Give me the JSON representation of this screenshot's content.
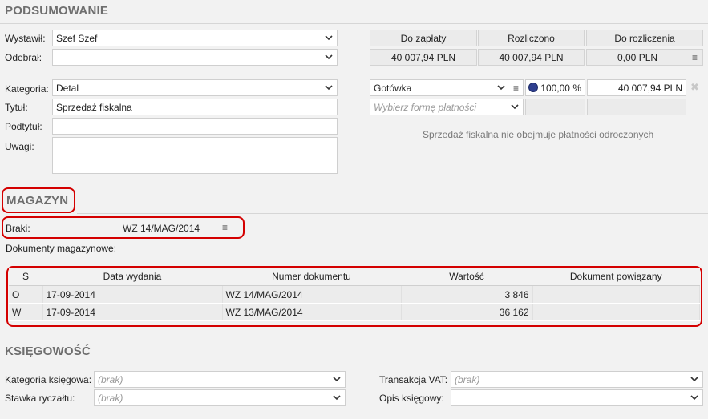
{
  "summary": {
    "title": "PODSUMOWANIE",
    "issued_label": "Wystawił:",
    "issued_value": "Szef Szef",
    "received_label": "Odebrał:",
    "received_value": "",
    "category_label": "Kategoria:",
    "category_value": "Detal",
    "title_label": "Tytuł:",
    "title_value": "Sprzedaż fiskalna",
    "subtitle_label": "Podtytuł:",
    "subtitle_value": "",
    "notes_label": "Uwagi:",
    "notes_value": "",
    "totals": {
      "to_pay_label": "Do zapłaty",
      "settled_label": "Rozliczono",
      "to_settle_label": "Do rozliczenia",
      "to_pay_value": "40 007,94 PLN",
      "settled_value": "40 007,94 PLN",
      "to_settle_value": "0,00 PLN"
    },
    "payment": {
      "method": "Gotówka",
      "percent": "100,00 %",
      "amount": "40 007,94 PLN",
      "new_method_placeholder": "Wybierz formę płatności",
      "note": "Sprzedaż fiskalna nie obejmuje płatności odroczonych"
    }
  },
  "warehouse": {
    "title": "MAGAZYN",
    "shortages_label": "Braki:",
    "shortages_value": "WZ 14/MAG/2014",
    "docs_label": "Dokumenty magazynowe:",
    "columns": [
      "S",
      "Data wydania",
      "Numer dokumentu",
      "Wartość",
      "Dokument powiązany"
    ],
    "rows": [
      {
        "s": "O",
        "date": "17-09-2014",
        "number": "WZ 14/MAG/2014",
        "value": "3 846",
        "linked": ""
      },
      {
        "s": "W",
        "date": "17-09-2014",
        "number": "WZ 13/MAG/2014",
        "value": "36 162",
        "linked": ""
      }
    ]
  },
  "accounting": {
    "title": "KSIĘGOWOŚĆ",
    "category_label": "Kategoria księgowa:",
    "category_value": "(brak)",
    "rate_label": "Stawka ryczałtu:",
    "rate_value": "(brak)",
    "vat_label": "Transakcja VAT:",
    "vat_value": "(brak)",
    "desc_label": "Opis księgowy:",
    "desc_value": ""
  },
  "colors": {
    "highlight": "#d40000",
    "section_title": "#6e6e6e",
    "payment_dot": "#2e3f8f"
  }
}
